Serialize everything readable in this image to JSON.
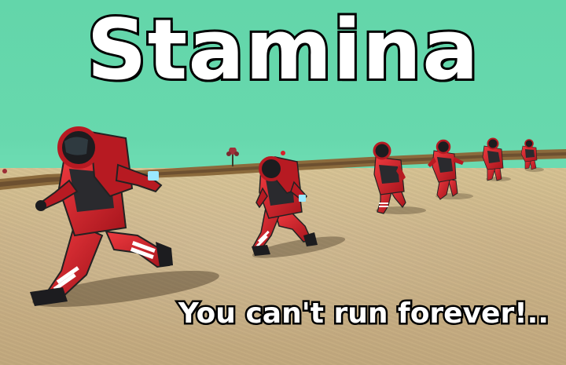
{
  "title": "Stamina",
  "subtitle": "You can't run forever!..",
  "colors": {
    "sky": "#63d6aa",
    "sand": "#cdb58a",
    "suit_red": "#d8202a",
    "suit_black": "#1c1c1f",
    "visor_glow": "#9ae8ff"
  },
  "scene": {
    "characters": [
      "astronaut-runner",
      "astronaut-runner",
      "astronaut-runner",
      "astronaut-runner",
      "astronaut-runner",
      "astronaut-runner"
    ]
  }
}
